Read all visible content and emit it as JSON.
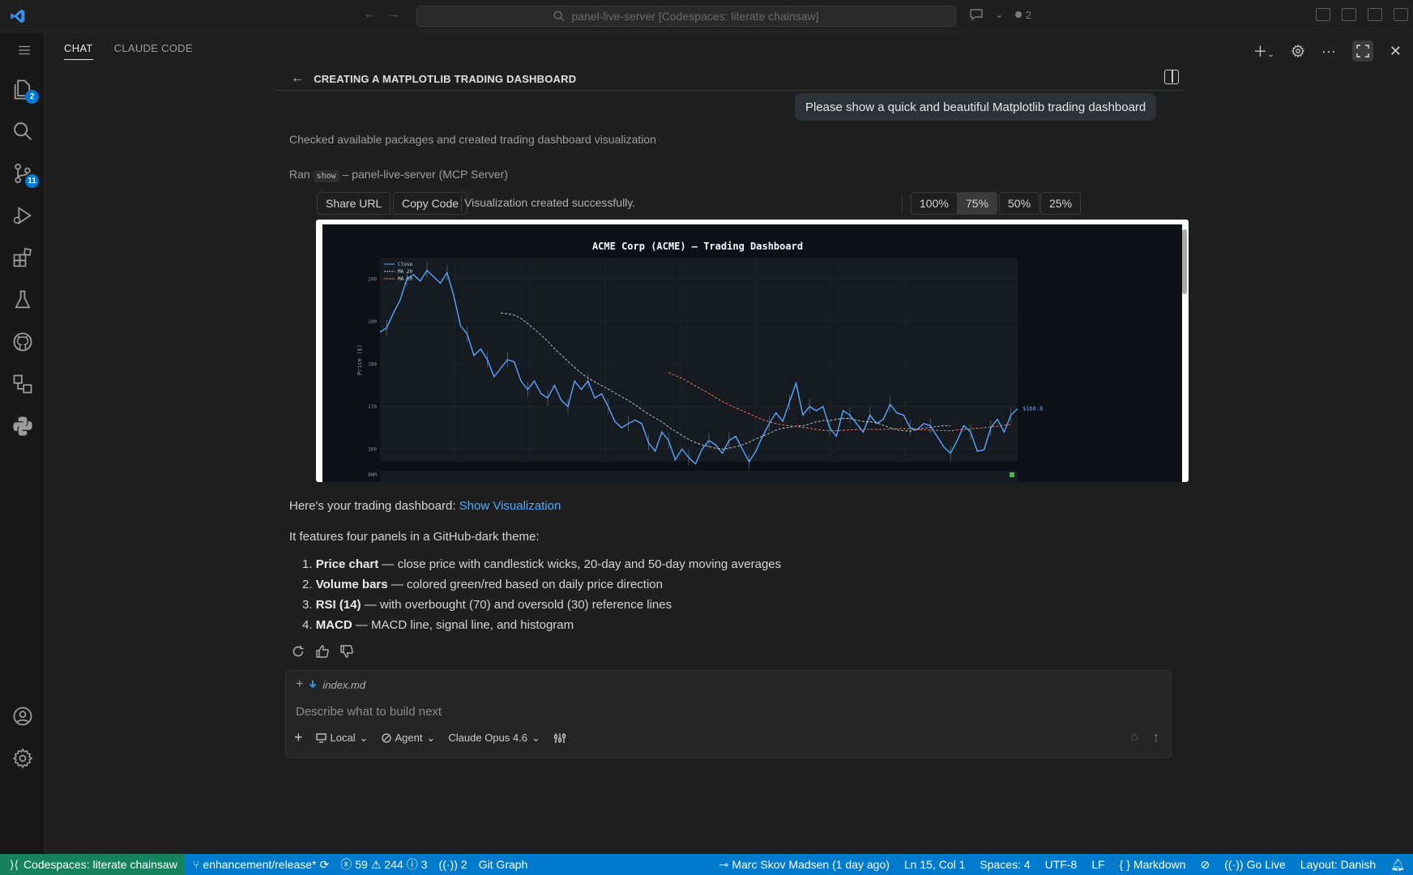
{
  "titlebar": {
    "search_text": "panel-live-server [Codespaces: literate chainsaw]",
    "chat_count": "2"
  },
  "activity": {
    "explorer_badge": "2",
    "scm_badge": "11"
  },
  "panel": {
    "tabs": [
      "CHAT",
      "CLAUDE CODE"
    ],
    "active_tab": "CHAT"
  },
  "conversation": {
    "title": "CREATING A MATPLOTLIB TRADING DASHBOARD",
    "user_message": "Please show a quick and beautiful Matplotlib trading dashboard",
    "step1": "Checked available packages and created trading dashboard visualization",
    "step2_prefix": "Ran",
    "step2_tool": "show",
    "step2_suffix": "– panel-live-server (MCP Server)"
  },
  "viz": {
    "share_url": "Share URL",
    "copy_code": "Copy Code",
    "status": "Visualization created successfully.",
    "zoom_options": [
      "100%",
      "75%",
      "50%",
      "25%"
    ],
    "selected_zoom": "75%"
  },
  "chart_data": {
    "type": "line",
    "title": "ACME Corp (ACME)  —  Trading Dashboard",
    "ylabel": "Price ($)",
    "ylim": [
      157,
      205
    ],
    "yticks": [
      "200",
      "190",
      "180",
      "170",
      "160"
    ],
    "volume_tick": "80M",
    "last_price_label": "$168.8",
    "legend": [
      "Close",
      "MA 20",
      "MA 50"
    ],
    "colors": {
      "close": "#58a6ff",
      "ma20": "#c9d1d9",
      "ma50": "#f78166",
      "bg": "#0d1117",
      "panel": "#161b22"
    },
    "series": [
      {
        "name": "Close",
        "values": [
          187.5,
          188.5,
          192,
          195,
          200,
          201,
          199.5,
          202,
          200.5,
          199,
          201.5,
          196,
          189,
          187,
          182,
          183.5,
          181,
          177,
          179,
          181,
          180.5,
          176,
          174,
          176,
          173,
          172,
          175,
          171.5,
          170,
          176,
          174,
          176,
          172,
          173,
          170,
          166.5,
          165,
          166,
          166.8,
          166,
          161.5,
          159.5,
          164,
          162,
          157.5,
          160,
          158,
          156.5,
          160,
          162,
          161,
          159,
          162,
          163,
          160,
          157,
          159.5,
          163,
          166,
          168.5,
          166.5,
          171,
          175.5,
          168,
          170,
          169,
          170,
          165,
          163,
          169,
          168,
          166,
          164,
          168,
          166,
          167,
          170.5,
          168.5,
          168,
          165,
          164.5,
          166,
          165.5,
          163,
          160.5,
          159,
          162,
          165.5,
          164,
          159.5,
          159.8,
          165,
          167,
          164,
          168,
          169.5
        ]
      },
      {
        "name": "MA 20",
        "start_index": 18,
        "values": [
          192,
          191.8,
          191.5,
          190.7,
          189.5,
          188.2,
          186.8,
          185.3,
          183.6,
          182.1,
          180.6,
          179.2,
          177.8,
          176.7,
          175.8,
          174.9,
          174.1,
          173.2,
          172.3,
          171.4,
          170.4,
          169.3,
          168.2,
          167.3,
          166.4,
          165.2,
          164.2,
          163.2,
          162.3,
          161.5,
          161,
          160.6,
          160.2,
          160,
          160.2,
          160.5,
          161,
          161.6,
          162.4,
          163,
          163.7,
          164.4,
          164.9,
          165.1,
          165.4,
          165.5,
          165.9,
          166.4,
          166.7,
          166.7,
          167,
          167.2,
          167.2,
          166.8,
          166.5,
          166.4,
          166.2,
          165.6,
          165,
          164.5,
          164.3,
          164.2,
          164.6,
          164.9,
          165.1,
          165.3,
          165.5,
          165.5
        ]
      },
      {
        "name": "MA 50",
        "start_index": 43,
        "values": [
          178,
          177.3,
          176.6,
          175.7,
          174.8,
          174,
          173.1,
          172.1,
          171.2,
          170.4,
          169.7,
          169,
          168.3,
          167.6,
          166.9,
          166.4,
          166,
          165.7,
          165.5,
          165.3,
          165.1,
          164.9,
          164.6,
          164.4,
          164.3,
          164.3,
          164.4,
          164.5,
          164.6,
          164.6,
          164.6,
          164.6,
          164.6,
          164.7,
          164.8,
          164.8,
          164.7,
          164.6,
          164.5,
          164.4,
          164.4,
          164.3,
          164.3,
          164.5,
          164.6,
          164.7,
          164.9,
          165,
          165.2,
          165.4,
          165.6,
          165.8
        ]
      }
    ]
  },
  "answer": {
    "intro_prefix": "Here's your trading dashboard:",
    "intro_link": "Show Visualization",
    "features_intro": "It features four panels in a GitHub-dark theme:",
    "items": [
      {
        "num": "1.",
        "bold": "Price chart",
        "rest": " — close price with candlestick wicks, 20-day and 50-day moving averages"
      },
      {
        "num": "2.",
        "bold": "Volume bars",
        "rest": " — colored green/red based on daily price direction"
      },
      {
        "num": "3.",
        "bold": "RSI (14)",
        "rest": " — with overbought (70) and oversold (30) reference lines"
      },
      {
        "num": "4.",
        "bold": "MACD",
        "rest": " — MACD line, signal line, and histogram"
      }
    ]
  },
  "input": {
    "attachment": "index.md",
    "placeholder": "Describe what to build next",
    "location": "Local",
    "mode": "Agent",
    "model": "Claude Opus 4.6"
  },
  "statusbar": {
    "remote": "Codespaces: literate chainsaw",
    "branch": "enhancement/release*",
    "errors": "59",
    "warnings": "244",
    "infos": "3",
    "ports": "2",
    "git_graph": "Git Graph",
    "blame": "Marc Skov Madsen (1 day ago)",
    "position": "Ln 15, Col 1",
    "spaces": "Spaces: 4",
    "encoding": "UTF-8",
    "eol": "LF",
    "language": "Markdown",
    "go_live": "Go Live",
    "layout": "Layout: Danish"
  }
}
